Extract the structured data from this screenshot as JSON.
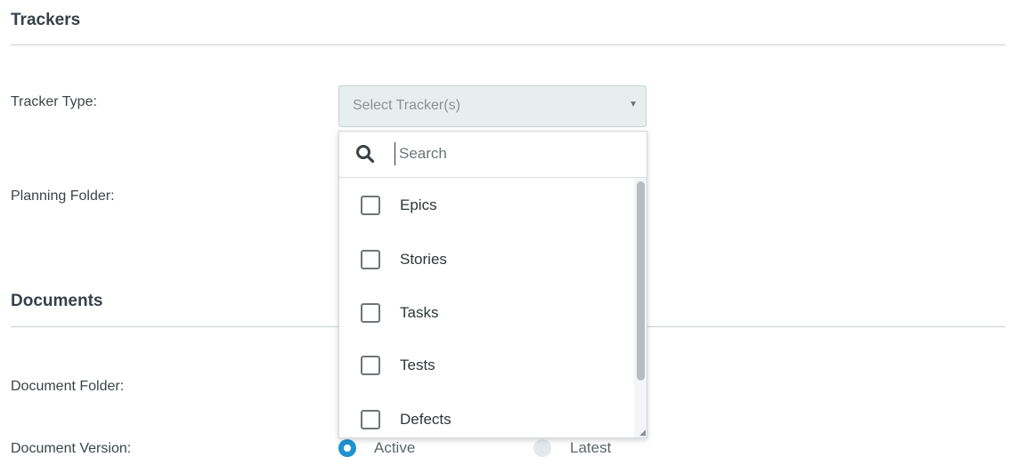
{
  "trackers_section": {
    "title": "Trackers"
  },
  "tracker_type": {
    "label": "Tracker Type:",
    "select_placeholder": "Select Tracker(s)",
    "caret_icon": "caret-down-icon"
  },
  "planning_folder": {
    "label": "Planning Folder:"
  },
  "dropdown": {
    "search_placeholder": "Search",
    "search_value": "",
    "options": [
      {
        "label": "Epics",
        "checked": false
      },
      {
        "label": "Stories",
        "checked": false
      },
      {
        "label": "Tasks",
        "checked": false
      },
      {
        "label": "Tests",
        "checked": false
      },
      {
        "label": "Defects",
        "checked": false
      }
    ]
  },
  "documents_section": {
    "title": "Documents"
  },
  "document_folder": {
    "label": "Document Folder:"
  },
  "document_version": {
    "label": "Document Version:",
    "options": [
      {
        "label": "Active",
        "selected": true
      },
      {
        "label": "Latest",
        "selected": false
      }
    ]
  },
  "colors": {
    "accent": "#1f93d1",
    "select_bg": "#e6efee"
  }
}
